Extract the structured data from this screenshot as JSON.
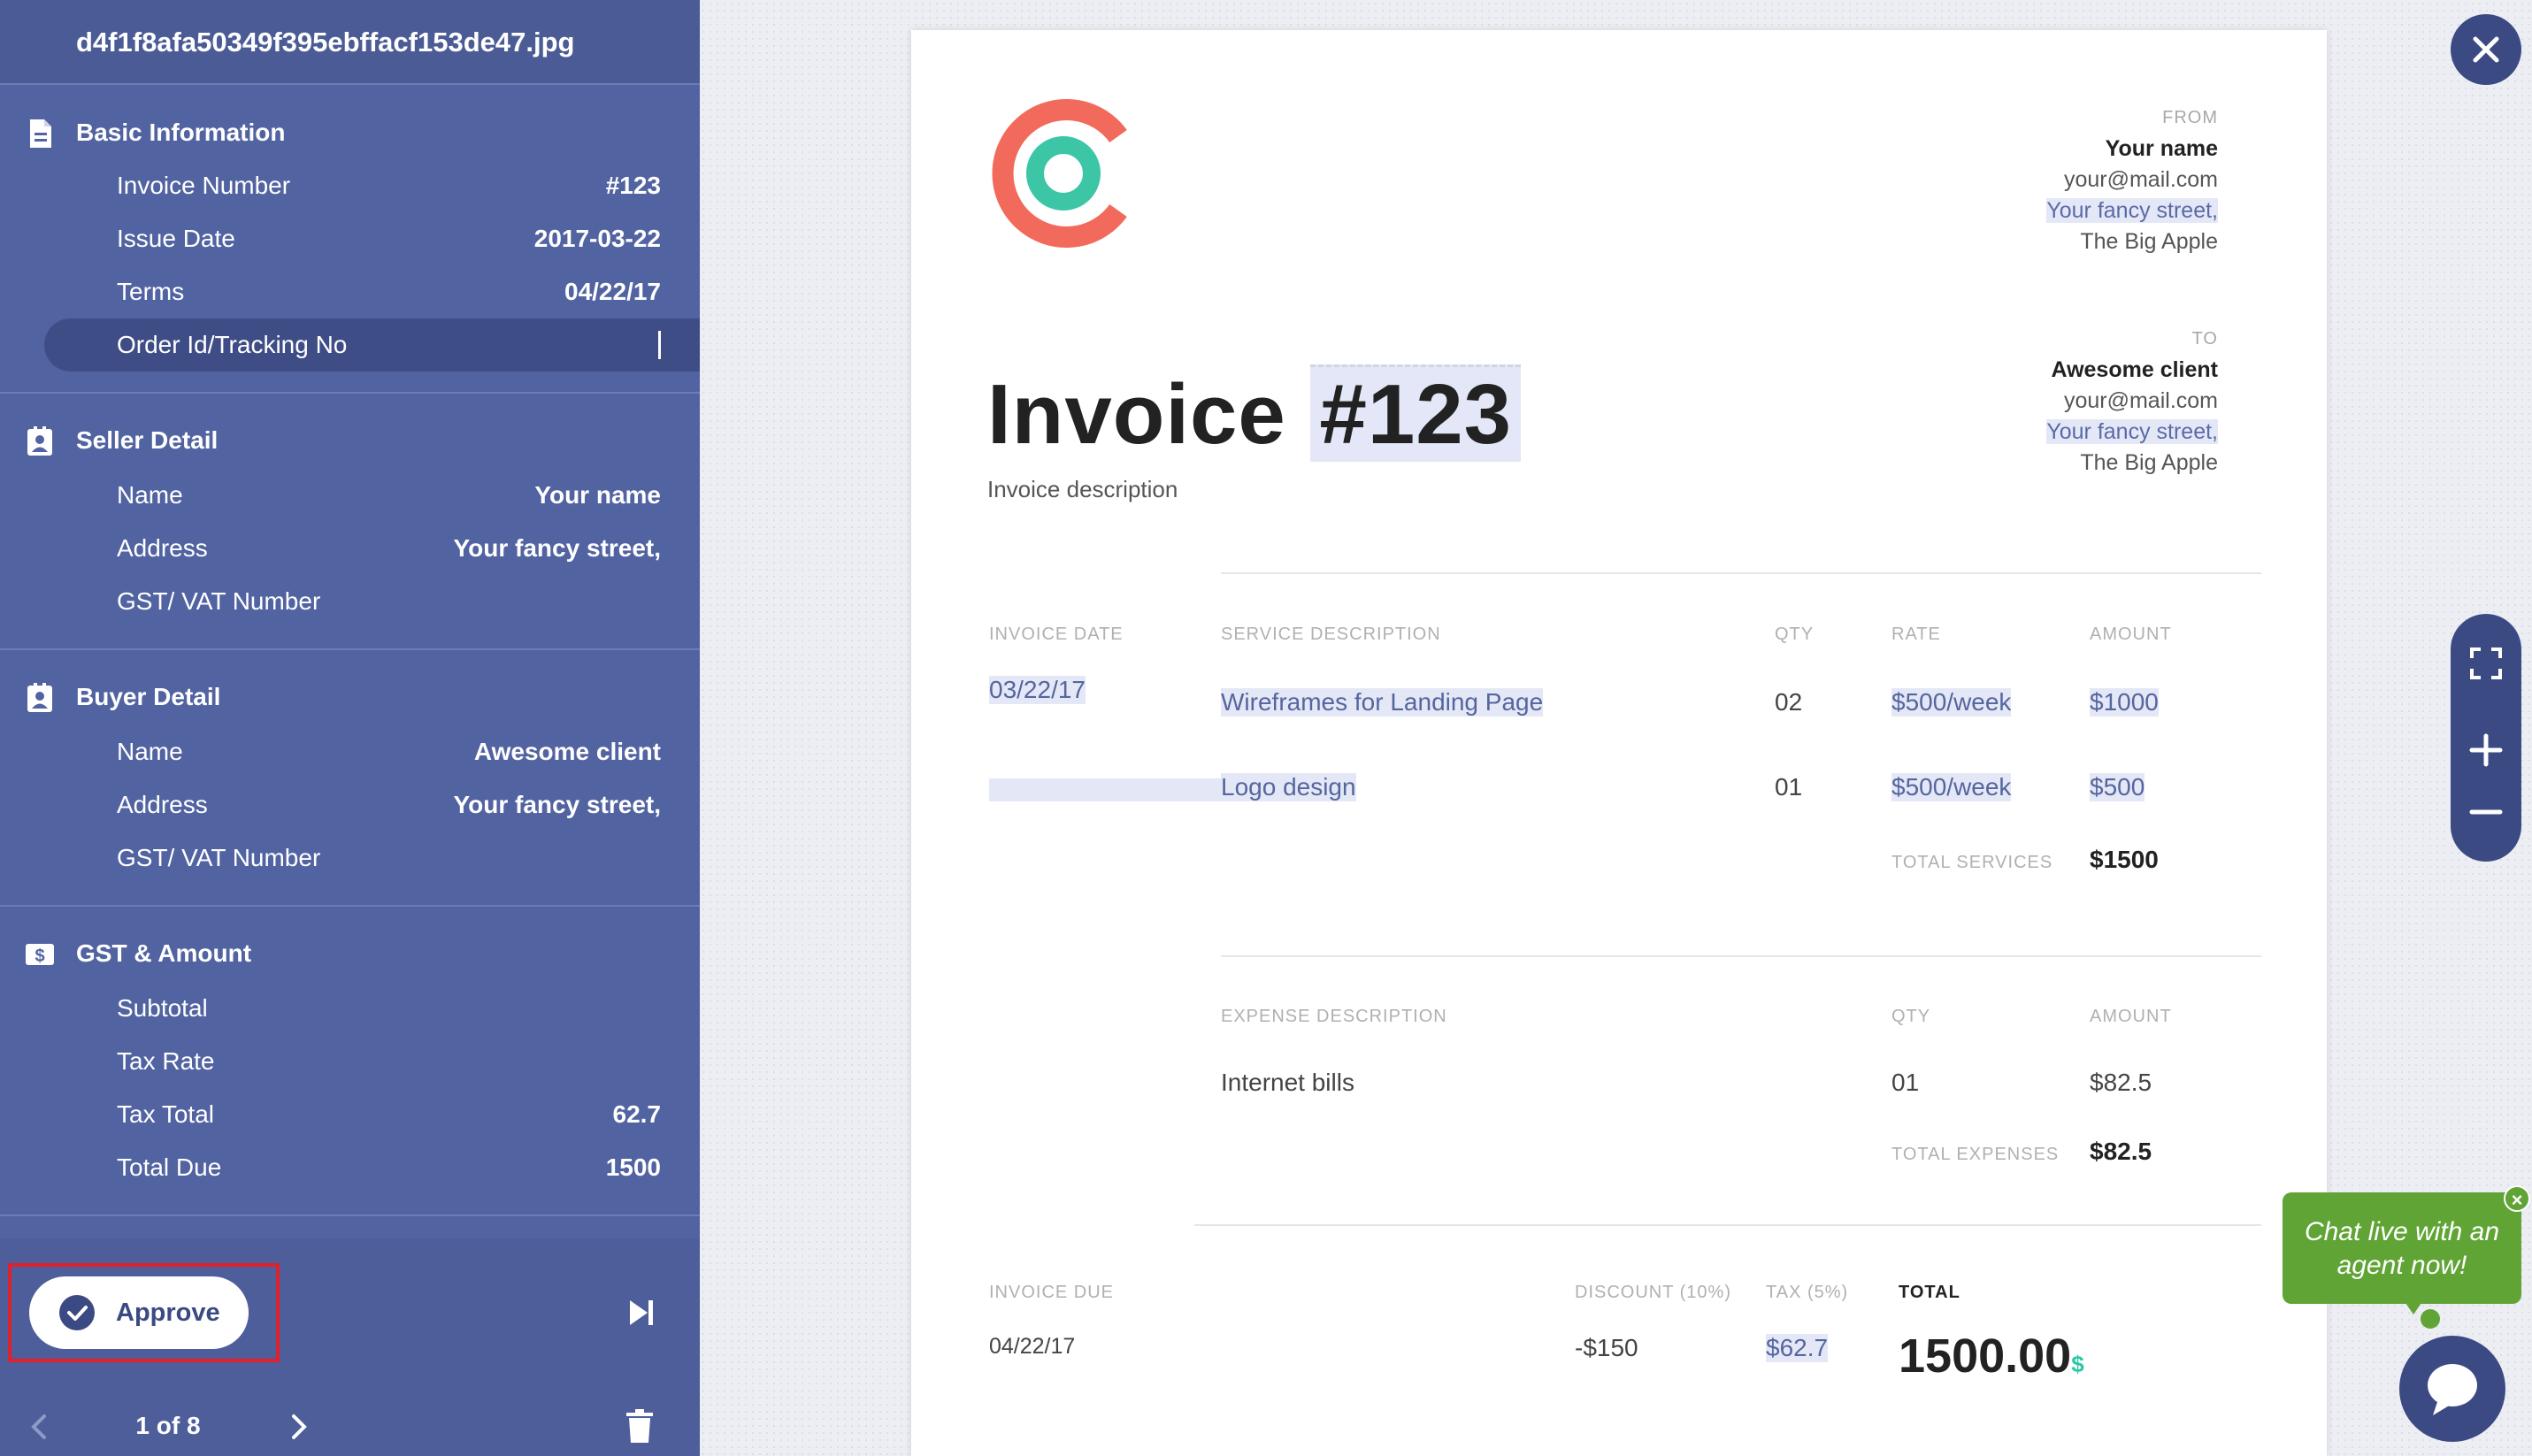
{
  "file_name": "d4f1f8afa50349f395ebffacf153de47.jpg",
  "sections": {
    "basic": {
      "title": "Basic Information",
      "invoice_number_label": "Invoice Number",
      "invoice_number_value": "#123",
      "issue_date_label": "Issue Date",
      "issue_date_value": "2017-03-22",
      "terms_label": "Terms",
      "terms_value": "04/22/17",
      "order_label": "Order Id/Tracking No",
      "order_value": ""
    },
    "seller": {
      "title": "Seller Detail",
      "name_label": "Name",
      "name_value": "Your name",
      "address_label": "Address",
      "address_value": "Your fancy street,",
      "gst_label": "GST/ VAT Number",
      "gst_value": ""
    },
    "buyer": {
      "title": "Buyer Detail",
      "name_label": "Name",
      "name_value": "Awesome client",
      "address_label": "Address",
      "address_value": "Your fancy street,",
      "gst_label": "GST/ VAT Number",
      "gst_value": ""
    },
    "gst": {
      "title": "GST & Amount",
      "subtotal_label": "Subtotal",
      "subtotal_value": "",
      "tax_rate_label": "Tax Rate",
      "tax_rate_value": "",
      "tax_total_label": "Tax Total",
      "tax_total_value": "62.7",
      "total_due_label": "Total Due",
      "total_due_value": "1500"
    }
  },
  "footer": {
    "approve_label": "Approve",
    "pager": "1 of 8"
  },
  "invoice": {
    "from": {
      "label": "FROM",
      "name": "Your name",
      "email": "your@mail.com",
      "street": "Your fancy street,",
      "city": "The Big Apple"
    },
    "to": {
      "label": "TO",
      "name": "Awesome client",
      "email": "your@mail.com",
      "street": "Your fancy street,",
      "city": "The Big Apple"
    },
    "title_word": "Invoice",
    "title_number": "#123",
    "description": "Invoice description",
    "services": {
      "headers": {
        "date": "INVOICE DATE",
        "desc": "SERVICE DESCRIPTION",
        "qty": "QTY",
        "rate": "RATE",
        "amount": "AMOUNT"
      },
      "invoice_date": "03/22/17",
      "rows": [
        {
          "desc": "Wireframes for Landing Page",
          "qty": "02",
          "rate": "$500/week",
          "amount": "$1000"
        },
        {
          "desc": "Logo design",
          "qty": "01",
          "rate": "$500/week",
          "amount": "$500"
        }
      ],
      "total_label": "TOTAL SERVICES",
      "total_value": "$1500"
    },
    "expenses": {
      "headers": {
        "desc": "EXPENSE DESCRIPTION",
        "qty": "QTY",
        "amount": "AMOUNT"
      },
      "rows": [
        {
          "desc": "Internet bills",
          "qty": "01",
          "amount": "$82.5"
        }
      ],
      "total_label": "TOTAL EXPENSES",
      "total_value": "$82.5"
    },
    "summary": {
      "due_label": "INVOICE DUE",
      "due_value": "04/22/17",
      "discount_label": "DISCOUNT (10%)",
      "discount_value": "-$150",
      "tax_label": "TAX (5%)",
      "tax_value": "$62.7",
      "total_label": "TOTAL",
      "total_value": "1500.00",
      "currency": "$"
    }
  },
  "chat": {
    "line1": "Chat live with an",
    "line2": "agent now!",
    "close": "×"
  },
  "colors": {
    "sidebar": "#5263a1",
    "accent_dark": "#3b4a82",
    "highlight": "#e4e8f6",
    "chat_green": "#5fa435",
    "approve_outline": "#e0202a"
  }
}
